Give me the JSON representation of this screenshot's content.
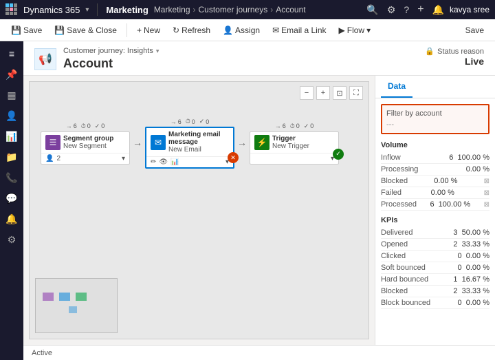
{
  "app": {
    "name": "Dynamics 365",
    "module": "Marketing"
  },
  "breadcrumb": {
    "items": [
      "Marketing",
      "Customer journeys",
      "Account"
    ]
  },
  "record": {
    "title": "Customer journey: Insights",
    "name": "Account",
    "status_label": "Status reason",
    "status_value": "Live"
  },
  "commands": {
    "save": "Save",
    "save_close": "Save & Close",
    "new": "New",
    "refresh": "Refresh",
    "assign": "Assign",
    "email_link": "Email a Link",
    "flow": "Flow"
  },
  "canvas": {
    "zoom_in": "+",
    "zoom_out": "−",
    "fit": "⊡",
    "fullscreen": "⛶"
  },
  "nodes": [
    {
      "type": "Segment group",
      "name": "New Segment",
      "icon_type": "purple",
      "icon": "☰",
      "stats": {
        "arrow": 6,
        "clock": 0,
        "check": 0
      },
      "footer_count": "2"
    },
    {
      "type": "Marketing email message",
      "name": "New Email",
      "icon_type": "blue",
      "icon": "✉",
      "stats": {
        "arrow": 6,
        "clock": 0,
        "check": 0
      },
      "selected": true
    },
    {
      "type": "Trigger",
      "name": "New Trigger",
      "icon_type": "green",
      "icon": "⚡",
      "stats": {
        "arrow": 6,
        "clock": 0,
        "check": 0
      },
      "has_check": true
    }
  ],
  "panel": {
    "tabs": [
      "Data"
    ],
    "filter_label": "Filter by account",
    "filter_value": "---",
    "volume_section": "Volume",
    "metrics_volume": [
      {
        "label": "Inflow",
        "value": "6",
        "pct": "100.00 %",
        "icon": false
      },
      {
        "label": "Processing",
        "value": "0.00 %",
        "pct": "",
        "icon": false
      },
      {
        "label": "Blocked",
        "value": "0.00 %",
        "pct": "",
        "icon": true
      },
      {
        "label": "Failed",
        "value": "0.00 %",
        "pct": "",
        "icon": true
      },
      {
        "label": "Processed",
        "value": "6",
        "pct": "100.00 %",
        "icon": true
      }
    ],
    "kpis_section": "KPIs",
    "metrics_kpis": [
      {
        "label": "Delivered",
        "value": "3",
        "pct": "50.00 %"
      },
      {
        "label": "Opened",
        "value": "2",
        "pct": "33.33 %"
      },
      {
        "label": "Clicked",
        "value": "0",
        "pct": "0.00 %"
      },
      {
        "label": "Soft bounced",
        "value": "0",
        "pct": "0.00 %"
      },
      {
        "label": "Hard bounced",
        "value": "1",
        "pct": "16.67 %"
      },
      {
        "label": "Blocked",
        "value": "2",
        "pct": "33.33 %"
      },
      {
        "label": "Block bounced",
        "value": "0",
        "pct": "0.00 %"
      }
    ]
  },
  "status_bar": {
    "text": "Active"
  },
  "sidebar_icons": [
    "≡",
    "📌",
    "👤",
    "📊",
    "📁",
    "📞",
    "💬",
    "🔔",
    "⚙"
  ]
}
